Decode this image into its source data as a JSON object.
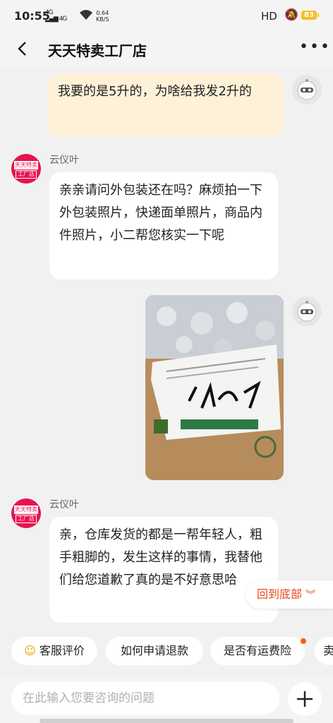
{
  "status_bar": {
    "time": "10:55",
    "signal1": "4G",
    "signal2": "4G",
    "speed_value": "0.64",
    "speed_unit": "KB/S",
    "hd": "HD",
    "battery": "83"
  },
  "header": {
    "title": "天天特卖工厂店"
  },
  "messages": [
    {
      "side": "right",
      "text": "我要的是5升的，为啥给我发2升的"
    },
    {
      "side": "left",
      "sender": "云仪叶",
      "text": "亲亲请问外包装还在吗？麻烦拍一下外包装照片，快递面单照片，商品内件照片，小二帮您核实一下呢"
    },
    {
      "side": "right",
      "type": "image",
      "handwriting": "1347"
    },
    {
      "side": "left",
      "sender": "云仪叶",
      "text": "亲，仓库发货的都是一帮年轻人，粗手粗脚的，发生这样的事情，我替他们给您道歉了真的是不好意思哈"
    }
  ],
  "shop_avatar": {
    "line1": "天天特卖",
    "line2": "工厂店"
  },
  "back_to_bottom": "回到底部",
  "quick_replies": [
    "客服评价",
    "如何申请退款",
    "是否有运费险",
    "卖"
  ],
  "input": {
    "placeholder": "在此输入您要咨询的问题"
  },
  "colors": {
    "accent": "#e44a1f",
    "user_bubble": "#fdf1d8",
    "shop_avatar": "#e8124f",
    "notify_dot": "#ff5a00"
  }
}
